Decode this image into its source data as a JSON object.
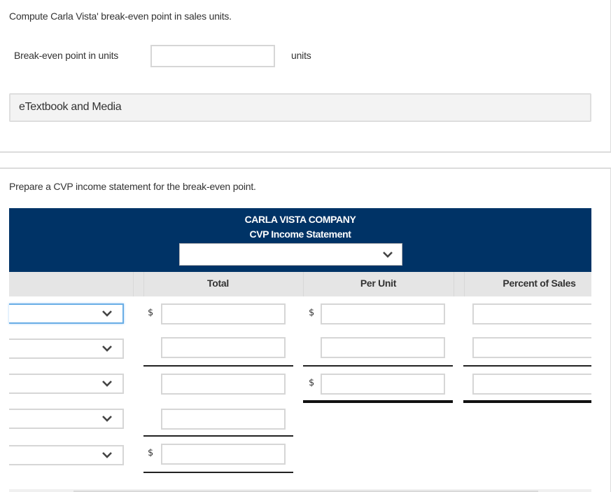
{
  "part1": {
    "question": "Compute Carla Vista' break-even point in sales units.",
    "breakeven_label": "Break-even point in units",
    "breakeven_value": "",
    "breakeven_unit": "units",
    "etextbook_label": "eTextbook and Media"
  },
  "part2": {
    "question": "Prepare a CVP income statement for the break-even point.",
    "statement": {
      "company": "CARLA VISTA COMPANY",
      "title": "CVP Income Statement",
      "period_select": {
        "selected": ""
      },
      "columns": [
        "Total",
        "Per Unit",
        "Percent of Sales"
      ],
      "currency_symbol": "$",
      "rows": [
        {
          "label_select": "",
          "total": "",
          "per_unit": "",
          "percent": ""
        },
        {
          "label_select": "",
          "total": "",
          "per_unit": "",
          "percent": ""
        },
        {
          "label_select": "",
          "total": "",
          "per_unit": "",
          "percent": ""
        },
        {
          "label_select": "",
          "total": ""
        },
        {
          "label_select": "",
          "total": ""
        }
      ]
    }
  },
  "colors": {
    "header_blue": "#003366",
    "header_gray": "#e5e5e5",
    "focus_blue": "#6aaee6"
  }
}
